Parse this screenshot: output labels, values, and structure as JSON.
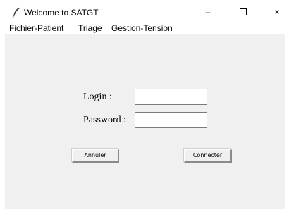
{
  "window": {
    "title": "Welcome to SATGT",
    "icon": "feather-icon",
    "controls": {
      "minimize": "–",
      "maximize": "☐",
      "close": "×"
    }
  },
  "menu": {
    "items": [
      {
        "label": "Fichier-Patient"
      },
      {
        "label": "Triage"
      },
      {
        "label": "Gestion-Tension"
      }
    ]
  },
  "form": {
    "login_label": "Login :",
    "login_value": "",
    "password_label": "Password :",
    "password_value": "",
    "cancel_button": "Annuler",
    "connect_button": "Connecter"
  },
  "colors": {
    "content_background": "#f0f0f0",
    "window_background": "#ffffff"
  }
}
